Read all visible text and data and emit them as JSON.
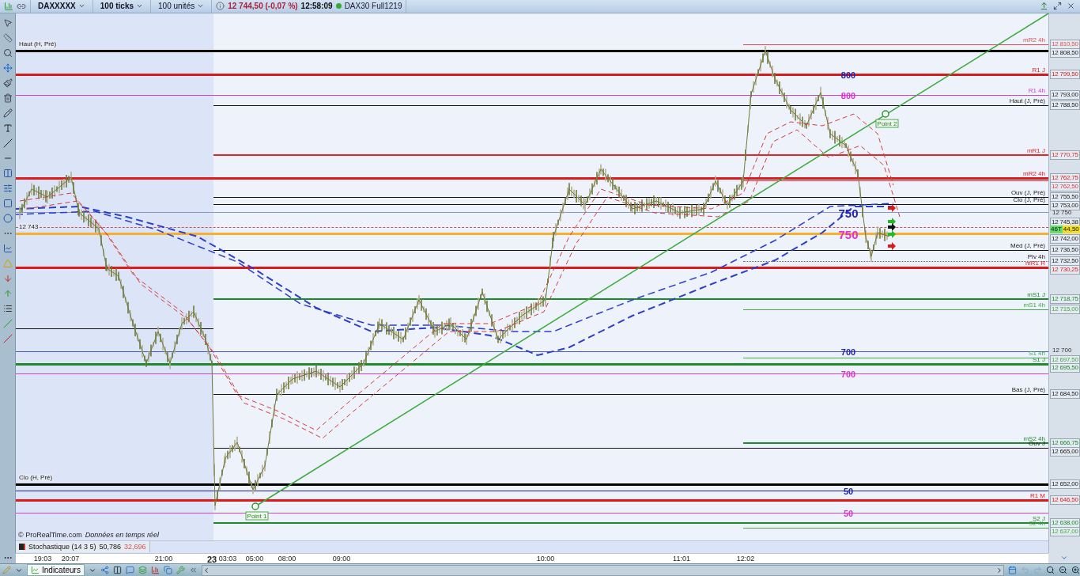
{
  "toolbar": {
    "instrument": "DAXXXXX",
    "period": "100 ticks",
    "units": "100 unités",
    "quote": "12 744,50 (-0,07 %)",
    "time": "12:58:09",
    "feed_online": true,
    "feed": "DAX30 Full1219"
  },
  "chart": {
    "levels": [
      {
        "kind": "level",
        "label": "mR2 4h",
        "price": "12 810,50",
        "color": "#e05050"
      },
      {
        "kind": "edge",
        "label": "Haut (H, Pré)",
        "price": "12 808,50",
        "color": "#000000"
      },
      {
        "kind": "level",
        "label": "R1 J",
        "price": "12 799,50",
        "color": "#d41c1c",
        "tag": {
          "text": "800",
          "color": "#2222b0"
        }
      },
      {
        "kind": "level",
        "label": "R1 4h",
        "price": "12 793,00",
        "color": "#cc44cc",
        "tag": {
          "text": "800",
          "color": "#e030d0"
        }
      },
      {
        "kind": "level",
        "label": "Haut (J, Pré)",
        "price": "12 788,50",
        "color": "#111111"
      },
      {
        "kind": "level",
        "label": "mR1 J",
        "price": "12 770,75",
        "color": "#e02828"
      },
      {
        "kind": "level",
        "label": "mR2 4h",
        "price": "12 762,75",
        "color": "#e01818"
      },
      {
        "kind": "level",
        "price": "12 762,50",
        "color": "#e04040"
      },
      {
        "kind": "level",
        "label": "Ouv (J, Pré)",
        "price": "12 755,50",
        "color": "#111111"
      },
      {
        "kind": "level",
        "label": "Clo (J, Pré)",
        "price": "12 753,00",
        "color": "#111111"
      },
      {
        "kind": "tick",
        "price": "12 750",
        "color": "#8a96c8",
        "tag": {
          "text": "750",
          "color": "#2222b0"
        }
      },
      {
        "kind": "level",
        "price": "12 745,38"
      },
      {
        "kind": "current",
        "label": "12 743",
        "count": "46T",
        "price": "44,50",
        "color": "#d05050"
      },
      {
        "kind": "level",
        "price": "12 742,00",
        "color": "#f5b030",
        "tag": {
          "text": "750",
          "color": "#e030d0"
        }
      },
      {
        "kind": "level",
        "label": "Méd (J, Pré)",
        "price": "12 736,50",
        "color": "#111111"
      },
      {
        "kind": "level",
        "label": "Piv 4h",
        "price": "12 732,50",
        "color": "#666666"
      },
      {
        "kind": "level",
        "label": "mR1 R",
        "price": "12 730,25",
        "color": "#e01818"
      },
      {
        "kind": "level",
        "label": "mS1 J",
        "price": "12 718,75",
        "color": "#1e8a2a"
      },
      {
        "kind": "level",
        "label": "mS1 4h",
        "price": "12 715,00",
        "color": "#44aa44"
      },
      {
        "kind": "level",
        "color": "#111111"
      },
      {
        "kind": "tick",
        "price": "12 700",
        "color": "#4a5ab8",
        "tag": {
          "text": "700",
          "color": "#2222b0"
        }
      },
      {
        "kind": "level",
        "label": "S1 4h",
        "price": "12 697,50",
        "color": "#44aa44"
      },
      {
        "kind": "level",
        "label": "S1 J",
        "price": "12 695,50",
        "color": "#1e8a2a"
      },
      {
        "kind": "level",
        "color": "#cc44cc",
        "tag": {
          "text": "700",
          "color": "#e030d0"
        }
      },
      {
        "kind": "level",
        "label": "Bas (J, Pré)",
        "price": "12 684,50",
        "color": "#111111"
      },
      {
        "kind": "level",
        "label": "mS2 4h",
        "price": "12 666,75",
        "color": "#1e8a2a"
      },
      {
        "kind": "level",
        "label": "Ouv J",
        "price": "12 665,00",
        "color": "#111111"
      },
      {
        "kind": "edge",
        "label": "Clo (H, Pré)",
        "price": "12 652,00",
        "color": "#000000"
      },
      {
        "kind": "level",
        "color": "#22228a",
        "tag": {
          "text": "50",
          "color": "#2222b0"
        }
      },
      {
        "kind": "level",
        "label": "R1 M",
        "price": "12 646,50",
        "color": "#e01818"
      },
      {
        "kind": "level",
        "color": "#cc44cc",
        "tag": {
          "text": "50",
          "color": "#e030d0"
        }
      },
      {
        "kind": "level",
        "label": "S2 J",
        "price": "12 638,00",
        "color": "#1e8a2a"
      },
      {
        "kind": "level",
        "label": "S2 4h",
        "price": "12 637,00",
        "color": "#44aa44"
      }
    ],
    "points": [
      {
        "label": "Point 1"
      },
      {
        "label": "Point 2"
      }
    ],
    "signals": [
      {
        "color": "#e01818"
      },
      {
        "color": "#22bb22"
      },
      {
        "color": "#111111"
      },
      {
        "color": "#22bb22"
      },
      {
        "color": "#e01818"
      }
    ],
    "copyright": "© ProRealTime.com",
    "feed_note": "Données en temps réel"
  },
  "indicator": {
    "name": "Stochastique (14 3 5)",
    "value_1": "50,786",
    "value_2": "32,696"
  },
  "time_axis": [
    {
      "text": "19:03",
      "kind": "time"
    },
    {
      "text": "20:07",
      "kind": "time"
    },
    {
      "text": "21:00",
      "kind": "time"
    },
    {
      "text": "23",
      "kind": "day"
    },
    {
      "text": "03:03",
      "kind": "time"
    },
    {
      "text": "05:00",
      "kind": "time"
    },
    {
      "text": "08:00",
      "kind": "time"
    },
    {
      "text": "09:00",
      "kind": "time"
    },
    {
      "text": "10:00",
      "kind": "time"
    },
    {
      "text": "11:01",
      "kind": "time"
    },
    {
      "text": "12:02",
      "kind": "time"
    }
  ],
  "bottom_toolbar": {
    "indicators_button": "Indicateurs"
  }
}
